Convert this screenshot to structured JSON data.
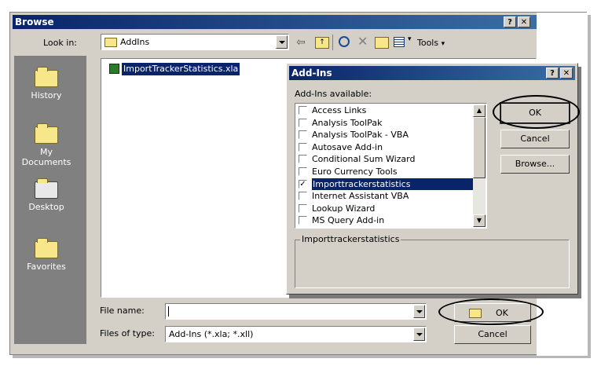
{
  "browse": {
    "title": "Browse",
    "help_label": "?",
    "close_label": "✕",
    "look_in_label": "Look in:",
    "look_in_value": "AddIns",
    "tools_label": "Tools",
    "places": [
      "History",
      "My Documents",
      "Desktop",
      "Favorites"
    ],
    "files": [
      "ImportTrackerStatistics.xla"
    ],
    "file_name_label": "File name:",
    "file_name_value": "",
    "files_of_type_label": "Files of type:",
    "files_of_type_value": "Add-Ins (*.xla; *.xll)",
    "ok_label": "OK",
    "cancel_label": "Cancel"
  },
  "addins": {
    "title": "Add-Ins",
    "help_label": "?",
    "close_label": "✕",
    "available_label": "Add-Ins available:",
    "items": [
      {
        "label": "Access Links",
        "checked": false
      },
      {
        "label": "Analysis ToolPak",
        "checked": false
      },
      {
        "label": "Analysis ToolPak - VBA",
        "checked": false
      },
      {
        "label": "Autosave Add-in",
        "checked": false
      },
      {
        "label": "Conditional Sum Wizard",
        "checked": false
      },
      {
        "label": "Euro Currency Tools",
        "checked": false
      },
      {
        "label": "Importtrackerstatistics",
        "checked": true,
        "selected": true
      },
      {
        "label": "Internet Assistant VBA",
        "checked": false
      },
      {
        "label": "Lookup Wizard",
        "checked": false
      },
      {
        "label": "MS Query Add-in",
        "checked": false
      }
    ],
    "description_title": "Importtrackerstatistics",
    "ok_label": "OK",
    "cancel_label": "Cancel",
    "browse_label": "Browse..."
  }
}
